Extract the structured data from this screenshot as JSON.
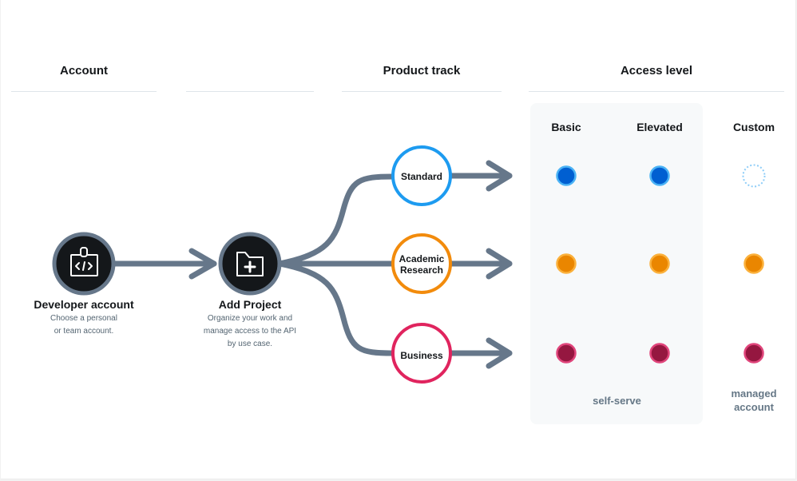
{
  "columns": {
    "account": "Account",
    "project": "",
    "product_track": "Product track",
    "access_level": "Access level"
  },
  "nodes": {
    "developer_account": {
      "title": "Developer account",
      "desc_line1": "Choose a personal",
      "desc_line2": "or team account.",
      "icon": "id-badge-code-icon"
    },
    "add_project": {
      "title": "Add Project",
      "desc_line1": "Organize your work and",
      "desc_line2": "manage access to the API",
      "desc_line3": "by use case.",
      "icon": "folder-plus-icon"
    }
  },
  "tracks": [
    {
      "key": "standard",
      "line1": "Standard",
      "line2": "",
      "color": "#1d9bf0"
    },
    {
      "key": "academic",
      "line1": "Academic",
      "line2": "Research",
      "color": "#f28b0c"
    },
    {
      "key": "business",
      "line1": "Business",
      "line2": "",
      "color": "#e0245e"
    }
  ],
  "levels": [
    {
      "key": "basic",
      "label": "Basic"
    },
    {
      "key": "elevated",
      "label": "Elevated"
    },
    {
      "key": "custom",
      "label": "Custom"
    }
  ],
  "availability": {
    "standard": [
      "filled",
      "filled",
      "empty"
    ],
    "academic": [
      "filled",
      "filled",
      "filled"
    ],
    "business": [
      "filled",
      "filled",
      "filled"
    ]
  },
  "dot_colors": {
    "standard": {
      "fill": "#005fd1",
      "ring": "#4bb3f5"
    },
    "academic": {
      "fill": "#ea8600",
      "ring": "#fbb13c"
    },
    "business": {
      "fill": "#951740",
      "ring": "#e0457b"
    },
    "empty_ring": "#8ecdf8"
  },
  "footer": {
    "self_serve": "self-serve",
    "managed_line1": "managed",
    "managed_line2": "account"
  },
  "colors": {
    "connector": "#66778a",
    "node_fill": "#14171a",
    "node_ring": "#66778a",
    "panel_bg": "#f7f9fa"
  }
}
